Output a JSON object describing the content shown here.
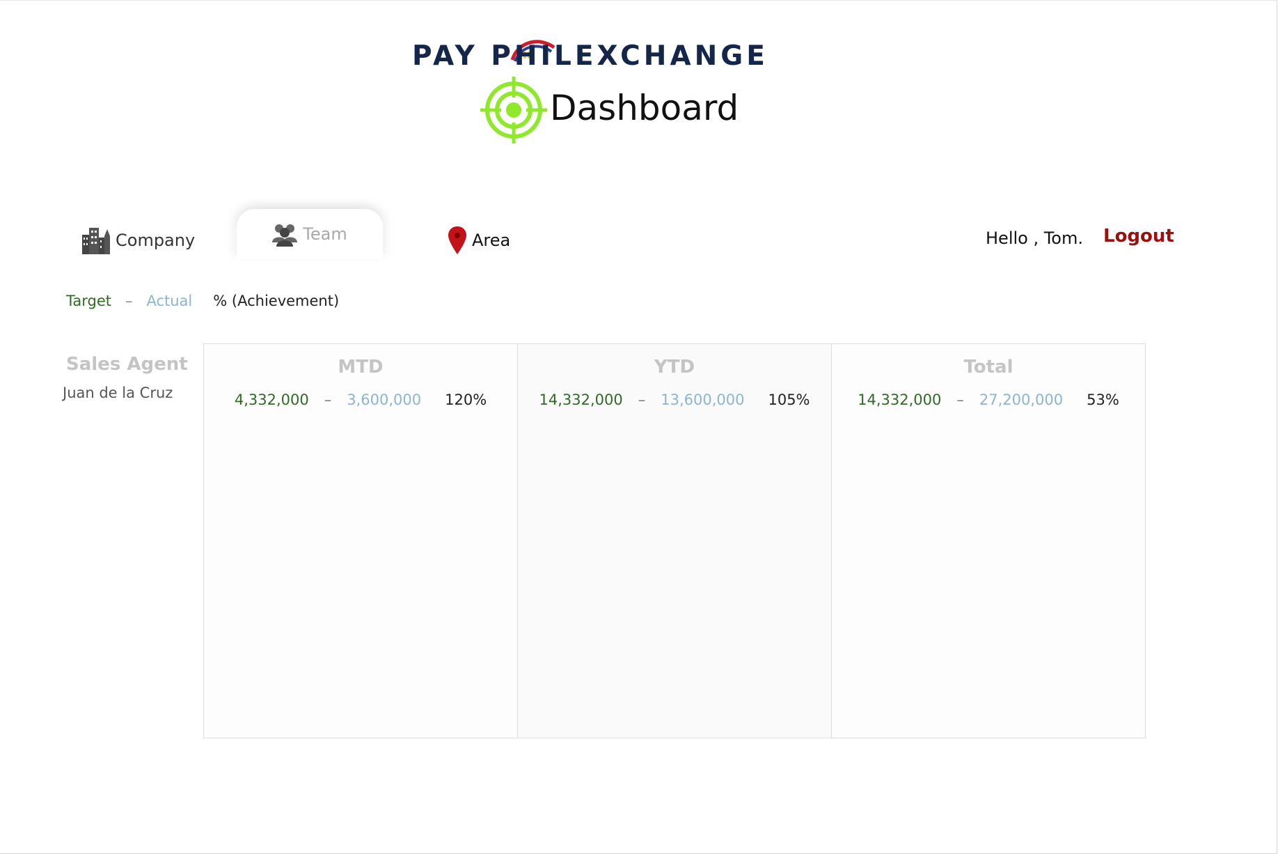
{
  "brand": {
    "logo_text": "PAY PHILEXCHANGE",
    "title": "Dashboard"
  },
  "tabs": [
    {
      "label": "Company",
      "icon": "buildings-icon",
      "active": false
    },
    {
      "label": "Team",
      "icon": "team-icon",
      "active": true
    },
    {
      "label": "Area",
      "icon": "map-pin-icon",
      "active": false
    }
  ],
  "user": {
    "greeting": "Hello , Tom.",
    "logout_label": "Logout"
  },
  "legend": {
    "target": "Target",
    "dash": "–",
    "actual": "Actual",
    "pct": "% (Achievement)"
  },
  "table": {
    "agent_header": "Sales Agent",
    "agent_name": "Juan de la Cruz",
    "periods": [
      {
        "label": "MTD",
        "target": "4,332,000",
        "actual": "3,600,000",
        "pct": "120%"
      },
      {
        "label": "YTD",
        "target": "14,332,000",
        "actual": "13,600,000",
        "pct": "105%"
      },
      {
        "label": "Total",
        "target": "14,332,000",
        "actual": "27,200,000",
        "pct": "53%"
      }
    ]
  },
  "colors": {
    "target": "#2f6b24",
    "actual": "#8bb5d1",
    "logout": "#a00d0d",
    "brand_navy": "#14264a",
    "target_icon": "#8fe82c"
  }
}
